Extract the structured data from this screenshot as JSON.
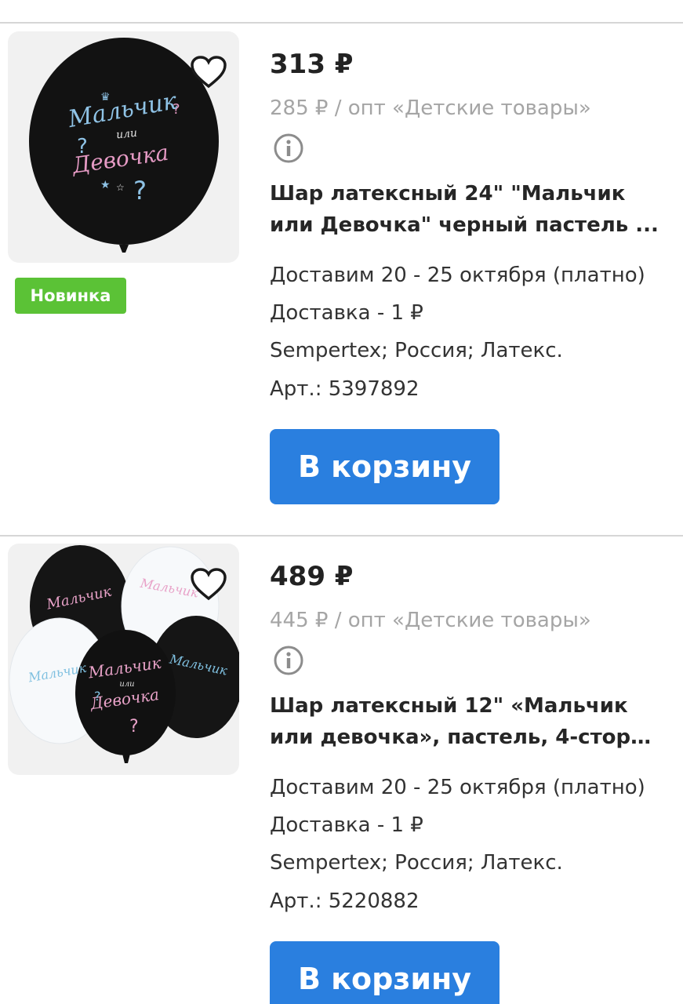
{
  "products": [
    {
      "price": "313 ₽",
      "wholesale": "285 ₽ / опт «Детские товары»",
      "badge": "Новинка",
      "title_line1": "Шар латексный 24\" \"Мальчик",
      "title_line2": "или Девочка\" черный пастель ...",
      "delivery_date": "Доставим 20 - 25 октября (платно)",
      "delivery_cost": "Доставка - 1 ₽",
      "specs": "Sempertex; Россия; Латекс.",
      "article": "Арт.: 5397892",
      "cart_label": "В корзину",
      "image_text": [
        "Мальчик",
        "или",
        "Девочка"
      ]
    },
    {
      "price": "489 ₽",
      "wholesale": "445 ₽ / опт «Детские товары»",
      "title_line1": "Шар латексный 12\" «Мальчик",
      "title_line2": "или девочка», пастель, 4-сторо...",
      "delivery_date": "Доставим 20 - 25 октября (платно)",
      "delivery_cost": "Доставка - 1 ₽",
      "specs": "Sempertex; Россия; Латекс.",
      "article": "Арт.: 5220882",
      "cart_label": "В корзину",
      "image_text": [
        "Мальчик",
        "или",
        "Девочка"
      ]
    }
  ],
  "icons": {
    "favorite": "heart-outline-icon",
    "info": "info-circle-icon"
  },
  "colors": {
    "accent": "#2a7fdf",
    "badge": "#5bc236",
    "muted_text": "#a5a5a5"
  }
}
